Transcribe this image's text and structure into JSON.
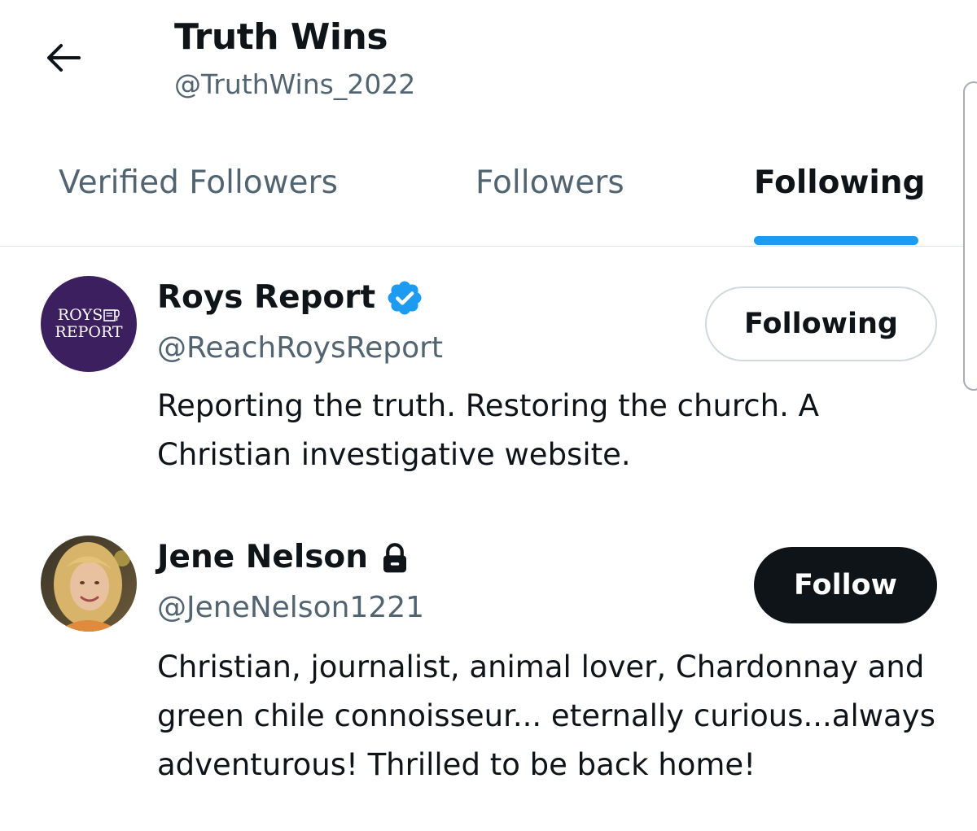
{
  "header": {
    "back_icon": "arrow-left-icon",
    "title": "Truth Wins",
    "handle": "@TruthWins_2022"
  },
  "tabs": [
    {
      "label": "Verified Followers",
      "active": false
    },
    {
      "label": "Followers",
      "active": false
    },
    {
      "label": "Following",
      "active": true
    }
  ],
  "accent_color": "#1d9bf0",
  "users": [
    {
      "name": "Roys Report",
      "badge": "verified-badge-icon",
      "handle": "@ReachRoysReport",
      "bio": "Reporting the truth. Restoring the church. A Christian investigative website.",
      "button_label": "Following",
      "avatar_text_line1": "ROYS",
      "avatar_text_line2": "REPORT"
    },
    {
      "name": "Jene Nelson",
      "badge": "lock-icon",
      "handle": "@JeneNelson1221",
      "bio": "Christian, journalist, animal lover, Chardonnay and green chile connoisseur... eternally curious...always adventurous! Thrilled to be back home!",
      "button_label": "Follow"
    }
  ]
}
